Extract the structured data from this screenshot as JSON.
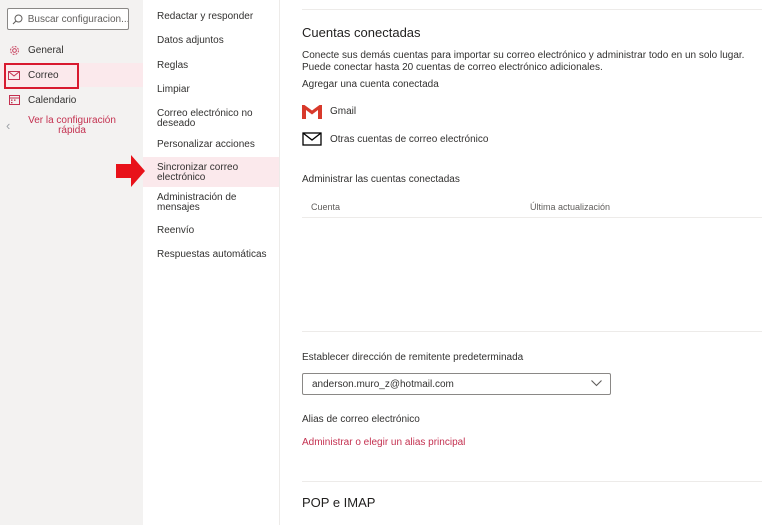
{
  "sidebar": {
    "search_placeholder": "Buscar configuracion...",
    "items": [
      {
        "label": "General",
        "icon": "gear-icon"
      },
      {
        "label": "Correo",
        "icon": "mail-icon"
      },
      {
        "label": "Calendario",
        "icon": "calendar-icon"
      }
    ],
    "quick_settings": "Ver la configuración rápida"
  },
  "submenu": {
    "items": [
      "Redactar y responder",
      "Datos adjuntos",
      "Reglas",
      "Limpiar",
      "Correo electrónico no deseado",
      "Personalizar acciones",
      "Sincronizar correo electrónico",
      "Administración de mensajes",
      "Reenvío",
      "Respuestas automáticas"
    ],
    "selected_index": 6
  },
  "content": {
    "title": "Cuentas conectadas",
    "description": "Conecte sus demás cuentas para importar su correo electrónico y administrar todo en un solo lugar. Puede conectar hasta 20 cuentas de correo electrónico adicionales.",
    "add_label": "Agregar una cuenta conectada",
    "gmail_label": "Gmail",
    "other_label": "Otras cuentas de correo electrónico",
    "manage_label": "Administrar las cuentas conectadas",
    "table_headers": [
      "Cuenta",
      "Última actualización"
    ],
    "sender_label": "Establecer dirección de remitente predeterminada",
    "sender_value": "anderson.muro_z@hotmail.com",
    "alias_label": "Alias de correo electrónico",
    "alias_link": "Administrar o elegir un alias principal",
    "pop_title": "POP e IMAP"
  },
  "colors": {
    "accent": "#c43150",
    "highlight_box": "#d8192f",
    "arrow": "#e8121a",
    "selected_bg": "#fbe9ec",
    "sidebar_bg": "#f3f2f1"
  }
}
